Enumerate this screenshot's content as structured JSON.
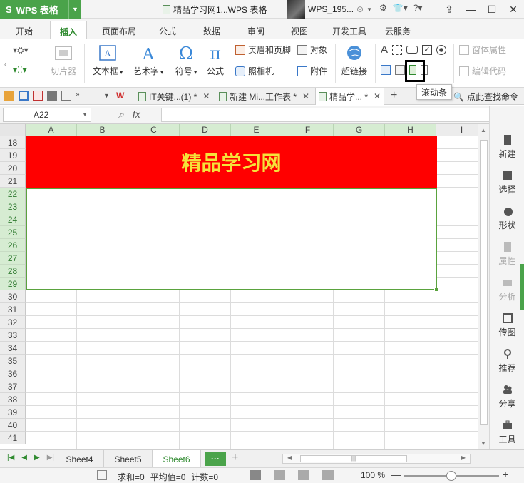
{
  "app": {
    "name": "WPS 表格",
    "logo_glyph": "S",
    "doc_title": "精品学习网1...WPS 表格",
    "user_name": "WPS_195...",
    "accent_color": "#4aa34a"
  },
  "menu": {
    "tabs": [
      "开始",
      "插入",
      "页面布局",
      "公式",
      "数据",
      "审阅",
      "视图",
      "开发工具",
      "云服务"
    ],
    "active": "插入"
  },
  "ribbon": {
    "clip": "切片器",
    "textbox": "文本框",
    "wordart": "艺术字",
    "symbol": "符号",
    "formula": "公式",
    "header_footer": "页眉和页脚",
    "object": "对象",
    "camera": "照相机",
    "attachment": "附件",
    "hyperlink": "超链接",
    "window_props": "窗体属性",
    "edit_code": "编辑代码",
    "tooltip": "滚动条"
  },
  "doc_tabs": [
    {
      "label": "IT关键...(1) *",
      "active": false
    },
    {
      "label": "新建 Mi...工作表 *",
      "active": false
    },
    {
      "label": "精品学... *",
      "active": true
    }
  ],
  "find_command": "点此查找命令",
  "formula_bar": {
    "name_box": "A22",
    "fx": "fx",
    "value": ""
  },
  "grid": {
    "columns": [
      "A",
      "B",
      "C",
      "D",
      "E",
      "F",
      "G",
      "H",
      "I"
    ],
    "rows": [
      "18",
      "19",
      "20",
      "21",
      "22",
      "23",
      "24",
      "25",
      "26",
      "27",
      "28",
      "29",
      "30",
      "31",
      "32",
      "33",
      "34",
      "35",
      "36",
      "37",
      "38",
      "39",
      "40",
      "41"
    ],
    "banner_text": "精品学习网",
    "banner_bg": "#ff0000",
    "banner_fg": "#f5e23a"
  },
  "sidebar": {
    "items": [
      "新建",
      "选择",
      "形状",
      "属性",
      "分析",
      "传图",
      "推荐",
      "分享",
      "工具"
    ]
  },
  "sheets": {
    "tabs": [
      "Sheet4",
      "Sheet5",
      "Sheet6"
    ],
    "active": "Sheet6",
    "more": "···",
    "add": "+"
  },
  "status": {
    "sum": "求和=0",
    "avg": "平均值=0",
    "count": "计数=0",
    "zoom": "100 %"
  }
}
